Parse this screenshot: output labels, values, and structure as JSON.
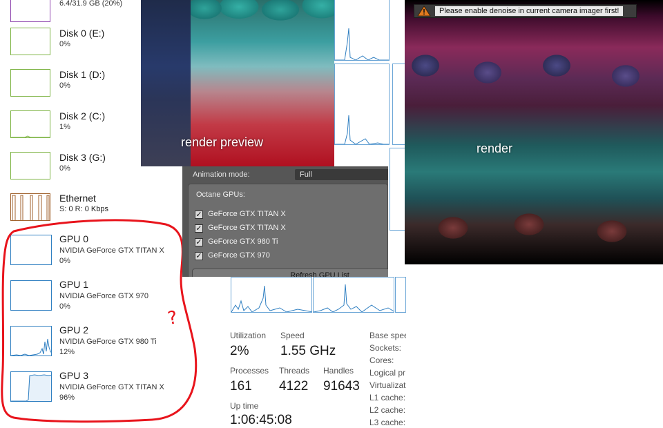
{
  "memory": {
    "value": "6.4/31.9 GB (20%)"
  },
  "disks": [
    {
      "title": "Disk 0 (E:)",
      "usage": "0%"
    },
    {
      "title": "Disk 1 (D:)",
      "usage": "0%"
    },
    {
      "title": "Disk 2 (C:)",
      "usage": "1%"
    },
    {
      "title": "Disk 3 (G:)",
      "usage": "0%"
    }
  ],
  "ethernet": {
    "title": "Ethernet",
    "s_label": "S:",
    "s_value": "0",
    "r_label": "R:",
    "r_value": "0 Kbps"
  },
  "gpus": [
    {
      "title": "GPU 0",
      "model": "NVIDIA GeForce GTX TITAN X",
      "usage": "0%"
    },
    {
      "title": "GPU 1",
      "model": "NVIDIA GeForce GTX 970",
      "usage": "0%"
    },
    {
      "title": "GPU 2",
      "model": "NVIDIA GeForce GTX 980 Ti",
      "usage": "12%"
    },
    {
      "title": "GPU 3",
      "model": "NVIDIA GeForce GTX TITAN X",
      "usage": "96%"
    }
  ],
  "annotation": {
    "mark": "?",
    "color": "#e8141c"
  },
  "render_preview": {
    "label": "render preview"
  },
  "render": {
    "label": "render"
  },
  "warning": {
    "text": "Please enable denoise in current camera imager first!"
  },
  "octane": {
    "animation_label": "Animation mode:",
    "animation_value": "Full",
    "gpus_title": "Octane GPUs:",
    "gpu_list": [
      {
        "name": "GeForce GTX TITAN X",
        "checked": true
      },
      {
        "name": "GeForce GTX TITAN X",
        "checked": true
      },
      {
        "name": "GeForce GTX 980 Ti",
        "checked": true
      },
      {
        "name": "GeForce GTX 970",
        "checked": true
      }
    ],
    "refresh_label": "Refresh GPU List"
  },
  "cpu": {
    "utilization_label": "Utilization",
    "utilization": "2%",
    "speed_label": "Speed",
    "speed": "1.55 GHz",
    "processes_label": "Processes",
    "processes": "161",
    "threads_label": "Threads",
    "threads": "4122",
    "handles_label": "Handles",
    "handles": "91643",
    "uptime_label": "Up time",
    "uptime": "1:06:45:08",
    "specs": [
      "Base speed",
      "Sockets:",
      "Cores:",
      "Logical pr",
      "Virtualizat",
      "L1 cache:",
      "L2 cache:",
      "L3 cache:"
    ]
  },
  "colors": {
    "disk": "#7cb342",
    "ethernet": "#a0622d",
    "gpu": "#2f7fc1",
    "memory": "#8e44ad"
  }
}
